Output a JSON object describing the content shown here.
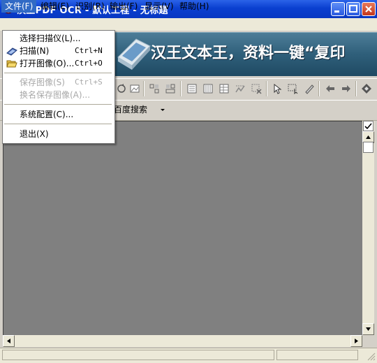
{
  "window": {
    "title": "汉王PDF OCR - 默认工程 - 无标题"
  },
  "menubar": {
    "items": [
      {
        "label": "文件(F)"
      },
      {
        "label": "编辑(E)"
      },
      {
        "label": "识别(R)"
      },
      {
        "label": "输出(F)"
      },
      {
        "label": "显示(V)"
      },
      {
        "label": "帮助(H)"
      }
    ]
  },
  "file_menu": {
    "items": [
      {
        "label": "选择扫描仪(L)...",
        "shortcut": ""
      },
      {
        "label": "扫描(N)",
        "shortcut": "Ctrl+N"
      },
      {
        "label": "打开图像(O)...",
        "shortcut": "Ctrl+O"
      },
      {
        "label": "保存图像(S)",
        "shortcut": "Ctrl+S"
      },
      {
        "label": "换名保存图像(A)...",
        "shortcut": ""
      },
      {
        "label": "系统配置(C)...",
        "shortcut": ""
      },
      {
        "label": "退出(X)",
        "shortcut": ""
      }
    ]
  },
  "banner": {
    "text": "汉王文本王，资料一键“复印"
  },
  "search_toolbar": {
    "label": "百度搜索"
  },
  "colors": {
    "title_bar": "#0a3fd0",
    "menu_highlight": "#316ac5",
    "canvas": "#808080"
  }
}
